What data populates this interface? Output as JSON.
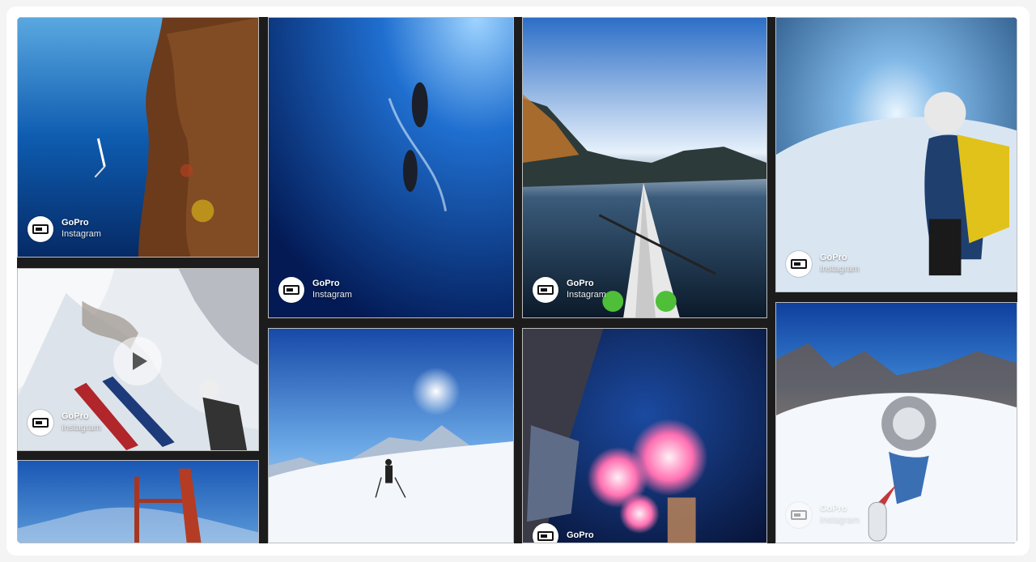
{
  "tiles": [
    {
      "id": "freediver",
      "author": "GoPro",
      "source": "Instagram"
    },
    {
      "id": "sea-lions",
      "author": "GoPro",
      "source": "Instagram"
    },
    {
      "id": "kayak",
      "author": "GoPro",
      "source": "Instagram"
    },
    {
      "id": "ice-cave",
      "author": "GoPro",
      "source": "Instagram"
    },
    {
      "id": "skier-cliff",
      "author": "GoPro",
      "source": "Instagram",
      "media": "video"
    },
    {
      "id": "mountain-hikers",
      "author": "",
      "source": ""
    },
    {
      "id": "fireworks",
      "author": "GoPro",
      "source": ""
    },
    {
      "id": "snowboarder",
      "author": "GoPro",
      "source": "Instagram"
    },
    {
      "id": "red-structure",
      "author": "",
      "source": ""
    }
  ],
  "icons": {
    "avatar": "gopro-logo-icon",
    "play": "play-icon"
  }
}
